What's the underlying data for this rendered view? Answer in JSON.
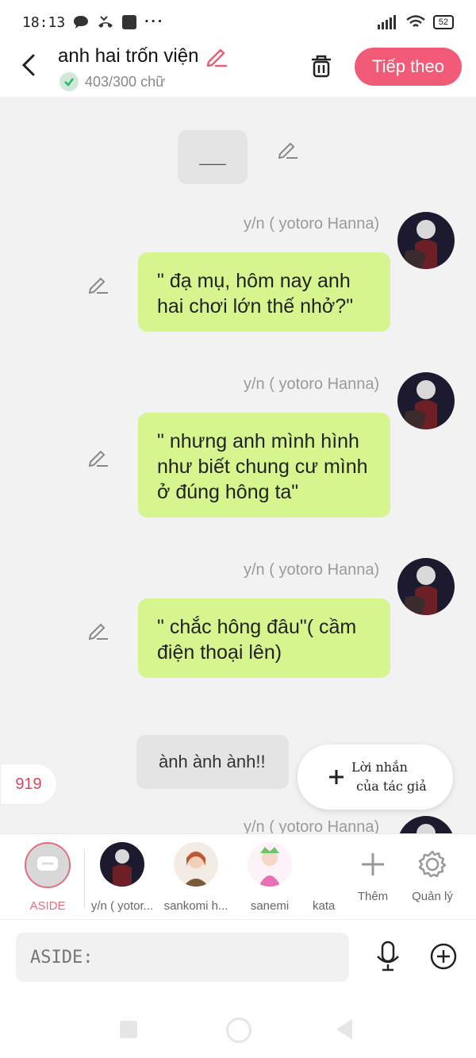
{
  "status_bar": {
    "time": "18:13",
    "battery": "52"
  },
  "header": {
    "title": "anh hai trốn viện",
    "word_count": "403/300 chữ",
    "next_button": "Tiếp theo"
  },
  "messages": [
    {
      "type": "placeholder",
      "text": "___"
    },
    {
      "type": "dialog",
      "speaker": "y/n ( yotoro Hanna)",
      "text": "\" đạ mụ, hôm nay anh hai chơi lớn thế nhở?\""
    },
    {
      "type": "dialog",
      "speaker": "y/n ( yotoro Hanna)",
      "text": "\" nhưng anh mình hình như biết chung cư mình ở đúng hông ta\""
    },
    {
      "type": "dialog",
      "speaker": "y/n ( yotoro Hanna)",
      "text": "\" chắc hông đâu\"( cầm điện thoại lên)"
    },
    {
      "type": "narration",
      "text": "ành ành ành!!"
    },
    {
      "type": "dialog",
      "speaker": "y/n ( yotoro Hanna)"
    }
  ],
  "floating": {
    "count": "919",
    "author_note_line1": "Lời nhắn",
    "author_note_line2": "của tác giả"
  },
  "characters": [
    {
      "label": "ASIDE",
      "selected": true,
      "color": "#e26f80"
    },
    {
      "label": "y/n ( yotor..."
    },
    {
      "label": "sankomi h..."
    },
    {
      "label": "sanemi"
    },
    {
      "label": "kata"
    },
    {
      "label": "Thêm",
      "icon": "plus-icon"
    },
    {
      "label": "Quản lý",
      "icon": "gear-icon"
    }
  ],
  "composer": {
    "placeholder": "ASIDE:"
  },
  "colors": {
    "accent": "#f25b77",
    "bubble_green": "#d6f58f",
    "bubble_grey": "#e4e4e4"
  }
}
